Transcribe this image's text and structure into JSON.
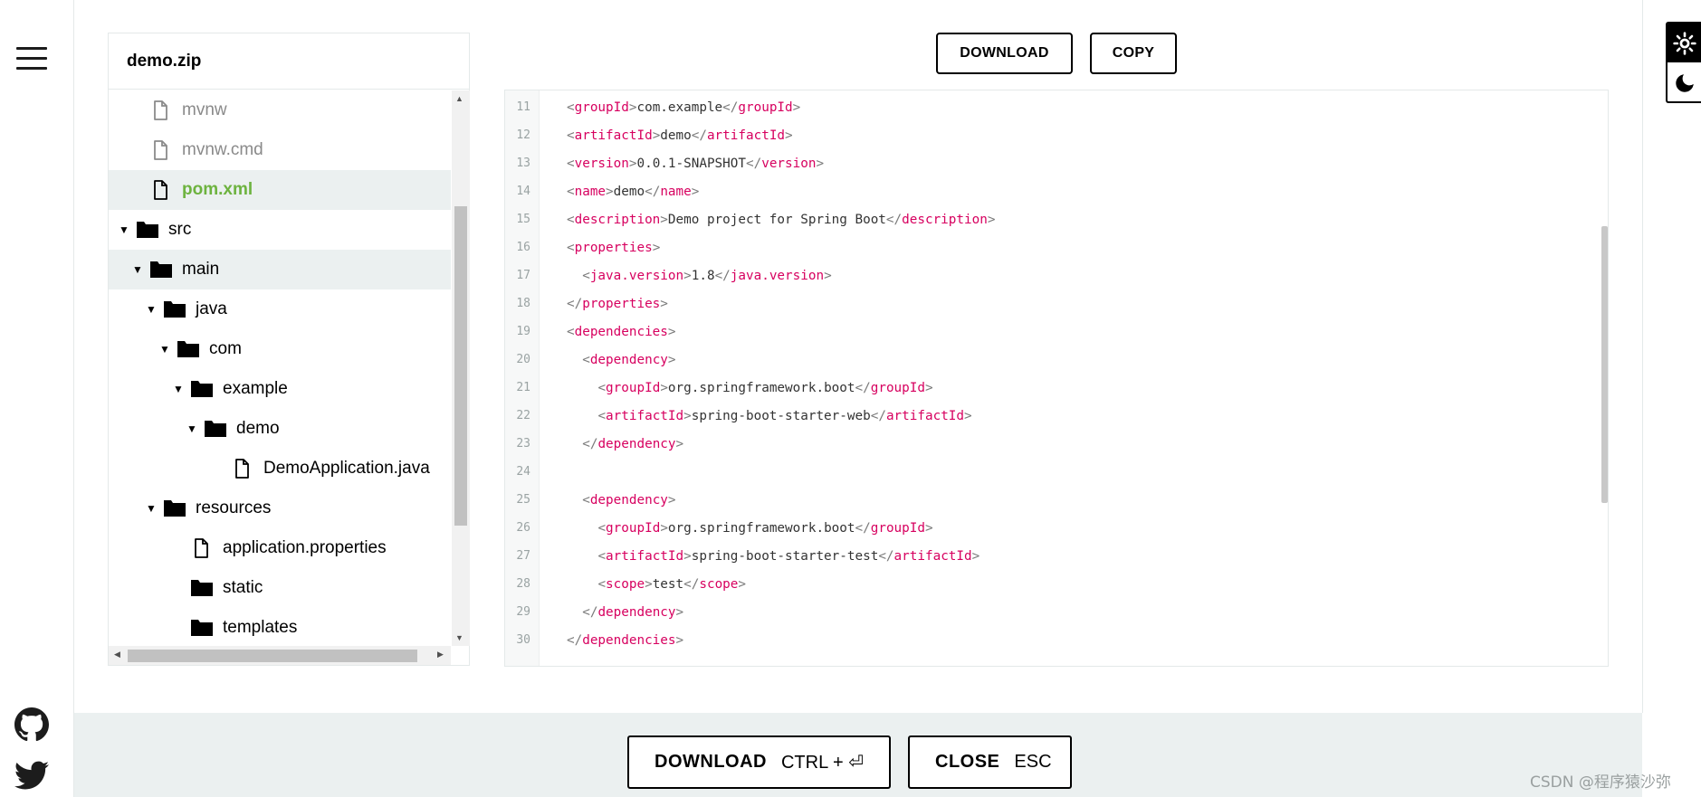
{
  "explorer": {
    "title": "demo.zip",
    "items": [
      {
        "label": "mvnw",
        "type": "file",
        "depth": 1,
        "state": "muted"
      },
      {
        "label": "mvnw.cmd",
        "type": "file",
        "depth": 1,
        "state": "muted"
      },
      {
        "label": "pom.xml",
        "type": "file",
        "depth": 1,
        "state": "selected"
      },
      {
        "label": "src",
        "type": "folder",
        "depth": 0,
        "expanded": true
      },
      {
        "label": "main",
        "type": "folder",
        "depth": 1,
        "expanded": true,
        "state": "hover"
      },
      {
        "label": "java",
        "type": "folder",
        "depth": 2,
        "expanded": true
      },
      {
        "label": "com",
        "type": "folder",
        "depth": 3,
        "expanded": true
      },
      {
        "label": "example",
        "type": "folder",
        "depth": 4,
        "expanded": true
      },
      {
        "label": "demo",
        "type": "folder",
        "depth": 5,
        "expanded": true
      },
      {
        "label": "DemoApplication.java",
        "type": "file",
        "depth": 7
      },
      {
        "label": "resources",
        "type": "folder",
        "depth": 2,
        "expanded": true
      },
      {
        "label": "application.properties",
        "type": "file",
        "depth": 4
      },
      {
        "label": "static",
        "type": "folder",
        "depth": 4,
        "expanded": false
      },
      {
        "label": "templates",
        "type": "folder",
        "depth": 4,
        "expanded": false
      }
    ]
  },
  "toolbar": {
    "download_label": "DOWNLOAD",
    "copy_label": "COPY"
  },
  "code": {
    "lines": [
      {
        "n": "11",
        "indent": "",
        "tag": "groupId",
        "text": "com.example"
      },
      {
        "n": "12",
        "indent": "",
        "tag": "artifactId",
        "text": "demo"
      },
      {
        "n": "13",
        "indent": "",
        "tag": "version",
        "text": "0.0.1-SNAPSHOT"
      },
      {
        "n": "14",
        "indent": "",
        "tag": "name",
        "text": "demo"
      },
      {
        "n": "15",
        "indent": "",
        "tag": "description",
        "text": "Demo project for Spring Boot"
      },
      {
        "n": "16",
        "indent": "",
        "tag": "properties",
        "kind": "open"
      },
      {
        "n": "17",
        "indent": "  ",
        "tag": "java.version",
        "text": "1.8"
      },
      {
        "n": "18",
        "indent": "",
        "tag": "properties",
        "kind": "close"
      },
      {
        "n": "19",
        "indent": "",
        "tag": "dependencies",
        "kind": "open"
      },
      {
        "n": "20",
        "indent": "  ",
        "tag": "dependency",
        "kind": "open"
      },
      {
        "n": "21",
        "indent": "    ",
        "tag": "groupId",
        "text": "org.springframework.boot"
      },
      {
        "n": "22",
        "indent": "    ",
        "tag": "artifactId",
        "text": "spring-boot-starter-web"
      },
      {
        "n": "23",
        "indent": "  ",
        "tag": "dependency",
        "kind": "close"
      },
      {
        "n": "24",
        "kind": "blank"
      },
      {
        "n": "25",
        "indent": "  ",
        "tag": "dependency",
        "kind": "open"
      },
      {
        "n": "26",
        "indent": "    ",
        "tag": "groupId",
        "text": "org.springframework.boot"
      },
      {
        "n": "27",
        "indent": "    ",
        "tag": "artifactId",
        "text": "spring-boot-starter-test"
      },
      {
        "n": "28",
        "indent": "    ",
        "tag": "scope",
        "text": "test"
      },
      {
        "n": "29",
        "indent": "  ",
        "tag": "dependency",
        "kind": "close"
      },
      {
        "n": "30",
        "indent": "",
        "tag": "dependencies",
        "kind": "close"
      }
    ]
  },
  "footer": {
    "download_label": "DOWNLOAD",
    "download_shortcut": "CTRL + ⏎",
    "close_label": "CLOSE",
    "close_shortcut": "ESC"
  },
  "watermark": "CSDN @程序猿沙弥",
  "colors": {
    "accent_green": "#6db33f",
    "xml_tag": "#d7005f",
    "footer_bg": "#ebf0f0"
  },
  "icons": [
    "menu-icon",
    "github-icon",
    "twitter-icon",
    "sun-icon",
    "moon-icon",
    "file-icon",
    "folder-icon"
  ]
}
